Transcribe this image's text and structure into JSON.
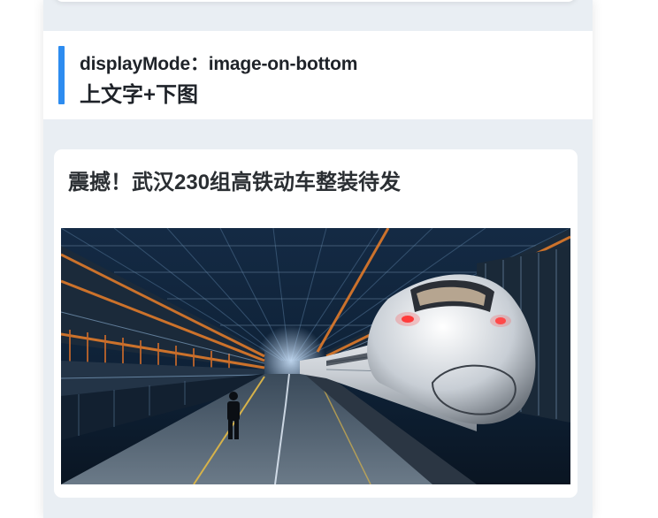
{
  "display_mode": {
    "key_label": "displayMode：image-on-bottom",
    "description": "上文字+下图"
  },
  "news_item": {
    "title": "震撼！武汉230组高铁动车整装待发",
    "image_alt": "high-speed-train-depot-photo"
  },
  "colors": {
    "accent": "#2d8cf0",
    "column_bg": "#e9eef3",
    "card_bg": "#ffffff",
    "text": "#1f2329"
  }
}
